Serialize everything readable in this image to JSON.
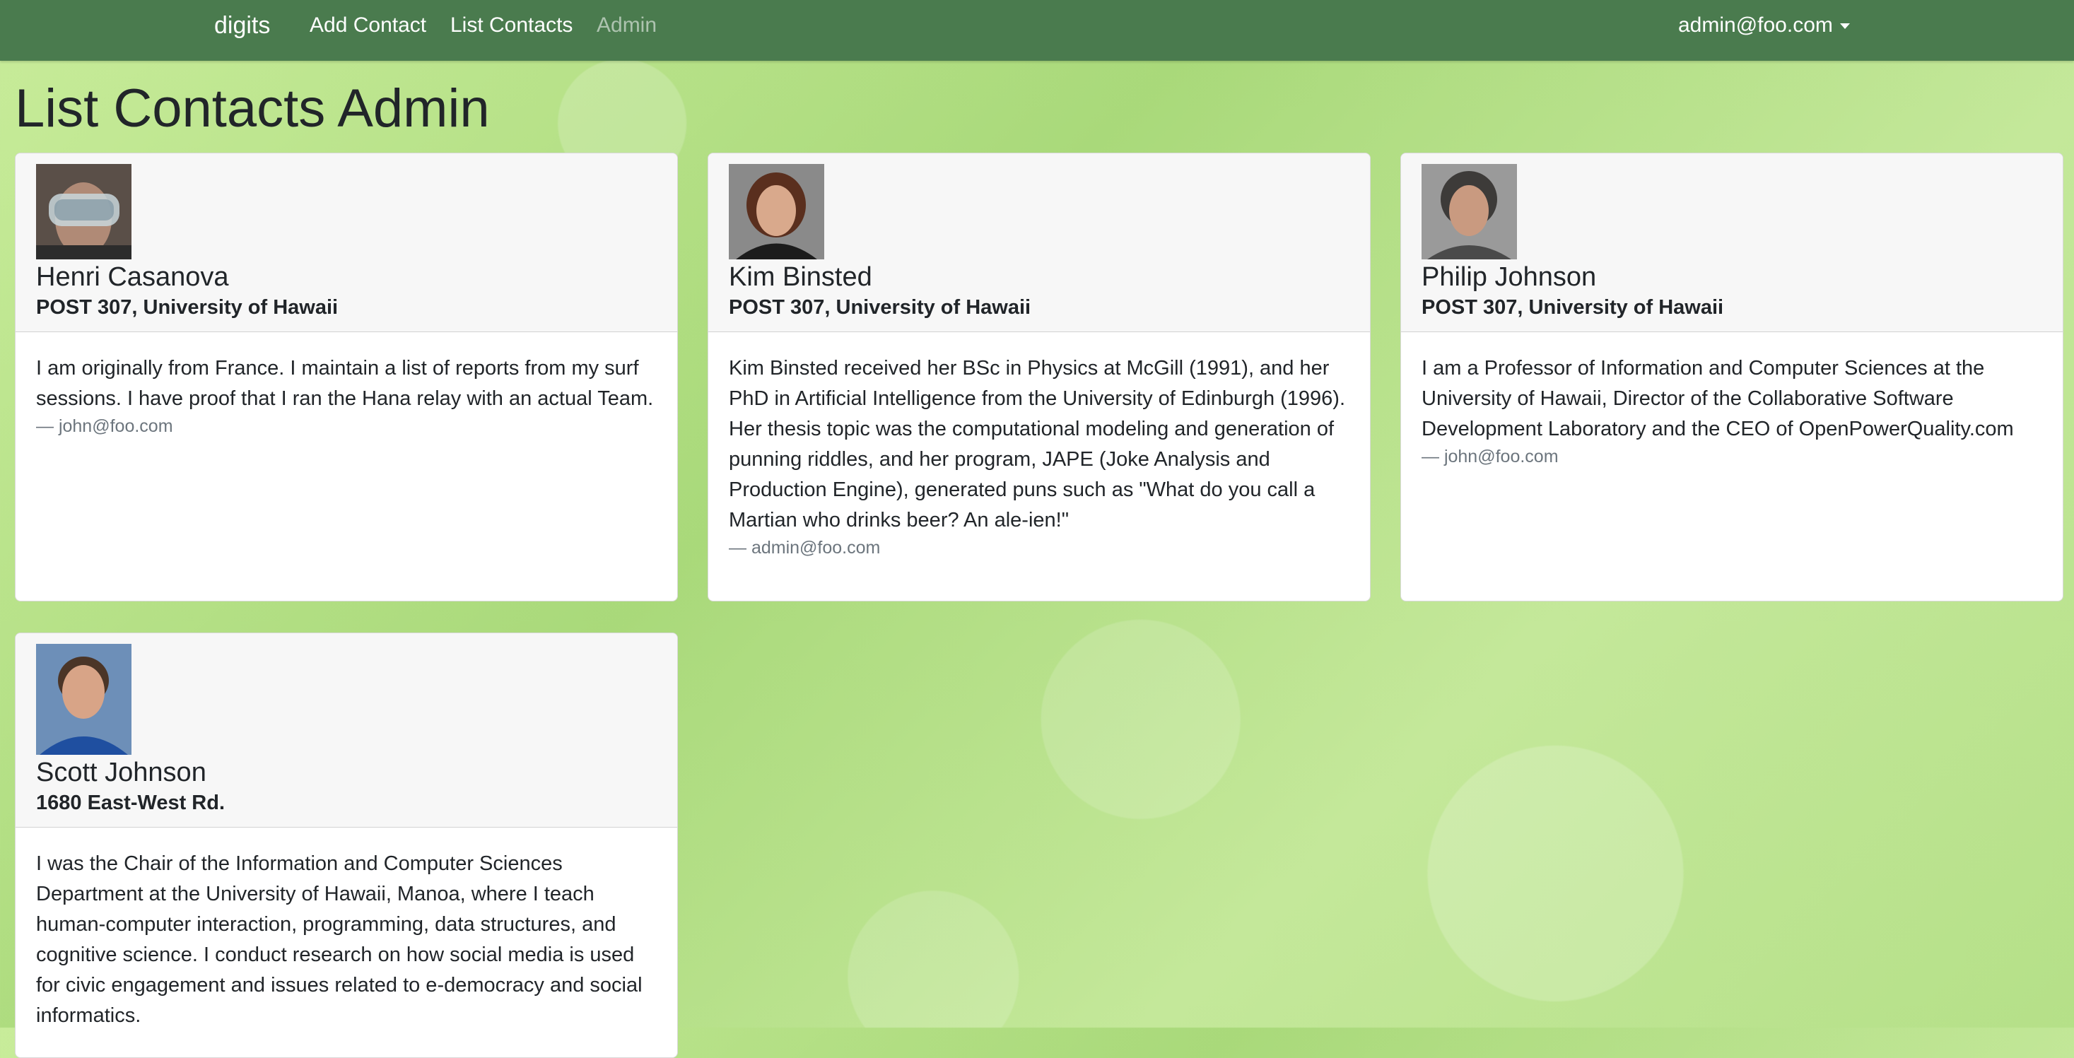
{
  "navbar": {
    "brand": "digits",
    "links": [
      {
        "label": "Add Contact"
      },
      {
        "label": "List Contacts"
      },
      {
        "label": "Admin"
      }
    ],
    "user": "admin@foo.com"
  },
  "page": {
    "title": "List Contacts Admin"
  },
  "contacts": [
    {
      "name": "Henri Casanova",
      "address": "POST 307, University of Hawaii",
      "description": "I am originally from France. I maintain a list of reports from my surf sessions. I have proof that I ran the Hana relay with an actual Team.",
      "owner": "— john@foo.com"
    },
    {
      "name": "Kim Binsted",
      "address": "POST 307, University of Hawaii",
      "description": "Kim Binsted received her BSc in Physics at McGill (1991), and her PhD in Artificial Intelligence from the University of Edinburgh (1996). Her thesis topic was the computational modeling and generation of punning riddles, and her program, JAPE (Joke Analysis and Production Engine), generated puns such as \"What do you call a Martian who drinks beer? An ale-ien!\"",
      "owner": "— admin@foo.com"
    },
    {
      "name": "Philip Johnson",
      "address": "POST 307, University of Hawaii",
      "description": "I am a Professor of Information and Computer Sciences at the University of Hawaii, Director of the Collaborative Software Development Laboratory and the CEO of OpenPowerQuality.com",
      "owner": "— john@foo.com"
    },
    {
      "name": "Scott Johnson",
      "address": "1680 East-West Rd.",
      "description": "I was the Chair of the Information and Computer Sciences Department at the University of Hawaii, Manoa, where I teach human-computer interaction, programming, data structures, and cognitive science. I conduct research on how social media is used for civic engagement and issues related to e-democracy and social informatics.",
      "owner": ""
    }
  ]
}
